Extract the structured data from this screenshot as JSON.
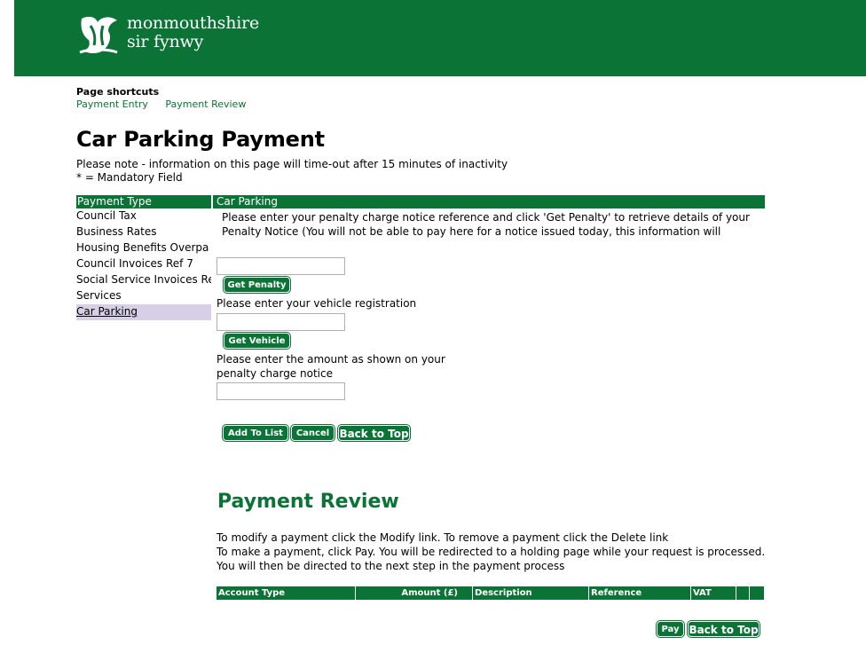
{
  "header": {
    "brand_line1": "monmouthshire",
    "brand_line2": "sir fynwy",
    "logo_icon": "dragon-logo-icon",
    "color": "#0b7336"
  },
  "shortcuts": {
    "title": "Page shortcuts",
    "links": [
      "Payment Entry",
      "Payment Review"
    ]
  },
  "page": {
    "title": "Car Parking Payment",
    "note_line1": "Please note - information on this page will time-out after 15 minutes of inactivity",
    "note_line2": "* = Mandatory Field"
  },
  "left_panel": {
    "heading": "Payment Type",
    "items": [
      "Council Tax",
      "Business Rates",
      "Housing Benefits Overpa",
      "Council Invoices Ref 7",
      "Social Service Invoices Re",
      "Services",
      "Car Parking"
    ],
    "selected": "Car Parking"
  },
  "form": {
    "heading": "Car Parking",
    "penalty_instruction": "Please enter your penalty charge notice reference and click 'Get Penalty' to retrieve details of your Penalty Notice (You will not be able to pay here for a notice issued today, this information will",
    "penalty_value": "",
    "get_penalty_label": "Get Penalty",
    "vehicle_instruction": "Please enter your vehicle registration",
    "vehicle_value": "",
    "get_vehicle_label": "Get Vehicle",
    "amount_instruction": "Please enter the amount as shown on your penalty charge notice",
    "amount_value": "",
    "add_to_list_label": "Add To List",
    "cancel_label": "Cancel",
    "back_to_top_label": "Back to Top"
  },
  "review": {
    "title": "Payment Review",
    "line1": "To modify a payment click the Modify link. To remove a payment click the Delete link",
    "line2": "To make a payment, click Pay. You will be redirected to a holding page while your request is processed. You will then be directed to the next step in the payment process",
    "columns": [
      "Account Type",
      "Amount (£)",
      "Description",
      "Reference",
      "VAT",
      "",
      ""
    ],
    "pay_label": "Pay",
    "back_to_top_label": "Back to Top"
  }
}
